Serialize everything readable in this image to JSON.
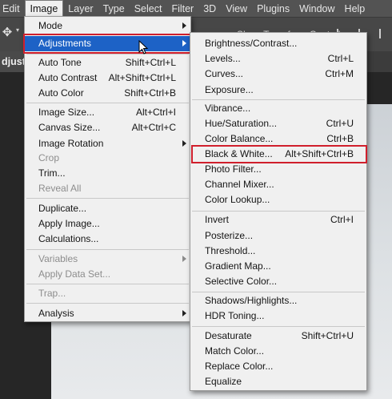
{
  "menubar": {
    "items": [
      "Edit",
      "Image",
      "Layer",
      "Type",
      "Select",
      "Filter",
      "3D",
      "View",
      "Plugins",
      "Window",
      "Help"
    ],
    "active": "Image"
  },
  "options_bar": {
    "show_transform_label": "Show Transform Controls"
  },
  "document_tab": {
    "label": "djust"
  },
  "image_menu": {
    "items": [
      {
        "label": "Mode",
        "shortcut": "",
        "submenu": true,
        "disabled": false
      },
      {
        "label": "Adjustments",
        "shortcut": "",
        "submenu": true,
        "disabled": false,
        "highlighted": true
      },
      {
        "label": "Auto Tone",
        "shortcut": "Shift+Ctrl+L",
        "submenu": false,
        "disabled": false
      },
      {
        "label": "Auto Contrast",
        "shortcut": "Alt+Shift+Ctrl+L",
        "submenu": false,
        "disabled": false
      },
      {
        "label": "Auto Color",
        "shortcut": "Shift+Ctrl+B",
        "submenu": false,
        "disabled": false
      },
      {
        "label": "Image Size...",
        "shortcut": "Alt+Ctrl+I",
        "submenu": false,
        "disabled": false
      },
      {
        "label": "Canvas Size...",
        "shortcut": "Alt+Ctrl+C",
        "submenu": false,
        "disabled": false
      },
      {
        "label": "Image Rotation",
        "shortcut": "",
        "submenu": true,
        "disabled": false
      },
      {
        "label": "Crop",
        "shortcut": "",
        "submenu": false,
        "disabled": true
      },
      {
        "label": "Trim...",
        "shortcut": "",
        "submenu": false,
        "disabled": false
      },
      {
        "label": "Reveal All",
        "shortcut": "",
        "submenu": false,
        "disabled": true
      },
      {
        "label": "Duplicate...",
        "shortcut": "",
        "submenu": false,
        "disabled": false
      },
      {
        "label": "Apply Image...",
        "shortcut": "",
        "submenu": false,
        "disabled": false
      },
      {
        "label": "Calculations...",
        "shortcut": "",
        "submenu": false,
        "disabled": false
      },
      {
        "label": "Variables",
        "shortcut": "",
        "submenu": true,
        "disabled": true
      },
      {
        "label": "Apply Data Set...",
        "shortcut": "",
        "submenu": false,
        "disabled": true
      },
      {
        "label": "Trap...",
        "shortcut": "",
        "submenu": false,
        "disabled": true
      },
      {
        "label": "Analysis",
        "shortcut": "",
        "submenu": true,
        "disabled": false
      }
    ]
  },
  "adjustments_menu": {
    "items": [
      {
        "label": "Brightness/Contrast...",
        "shortcut": ""
      },
      {
        "label": "Levels...",
        "shortcut": "Ctrl+L"
      },
      {
        "label": "Curves...",
        "shortcut": "Ctrl+M"
      },
      {
        "label": "Exposure...",
        "shortcut": ""
      },
      {
        "label": "Vibrance...",
        "shortcut": ""
      },
      {
        "label": "Hue/Saturation...",
        "shortcut": "Ctrl+U"
      },
      {
        "label": "Color Balance...",
        "shortcut": "Ctrl+B"
      },
      {
        "label": "Black & White...",
        "shortcut": "Alt+Shift+Ctrl+B",
        "boxed": true
      },
      {
        "label": "Photo Filter...",
        "shortcut": ""
      },
      {
        "label": "Channel Mixer...",
        "shortcut": ""
      },
      {
        "label": "Color Lookup...",
        "shortcut": ""
      },
      {
        "label": "Invert",
        "shortcut": "Ctrl+I"
      },
      {
        "label": "Posterize...",
        "shortcut": ""
      },
      {
        "label": "Threshold...",
        "shortcut": ""
      },
      {
        "label": "Gradient Map...",
        "shortcut": ""
      },
      {
        "label": "Selective Color...",
        "shortcut": ""
      },
      {
        "label": "Shadows/Highlights...",
        "shortcut": ""
      },
      {
        "label": "HDR Toning...",
        "shortcut": ""
      },
      {
        "label": "Desaturate",
        "shortcut": "Shift+Ctrl+U"
      },
      {
        "label": "Match Color...",
        "shortcut": ""
      },
      {
        "label": "Replace Color...",
        "shortcut": ""
      },
      {
        "label": "Equalize",
        "shortcut": ""
      }
    ]
  },
  "colors": {
    "highlight": "#1d62c6",
    "annotation_box": "#d01f2c",
    "menu_bg": "#f0f0f0",
    "disabled_text": "#8d8d8d"
  }
}
